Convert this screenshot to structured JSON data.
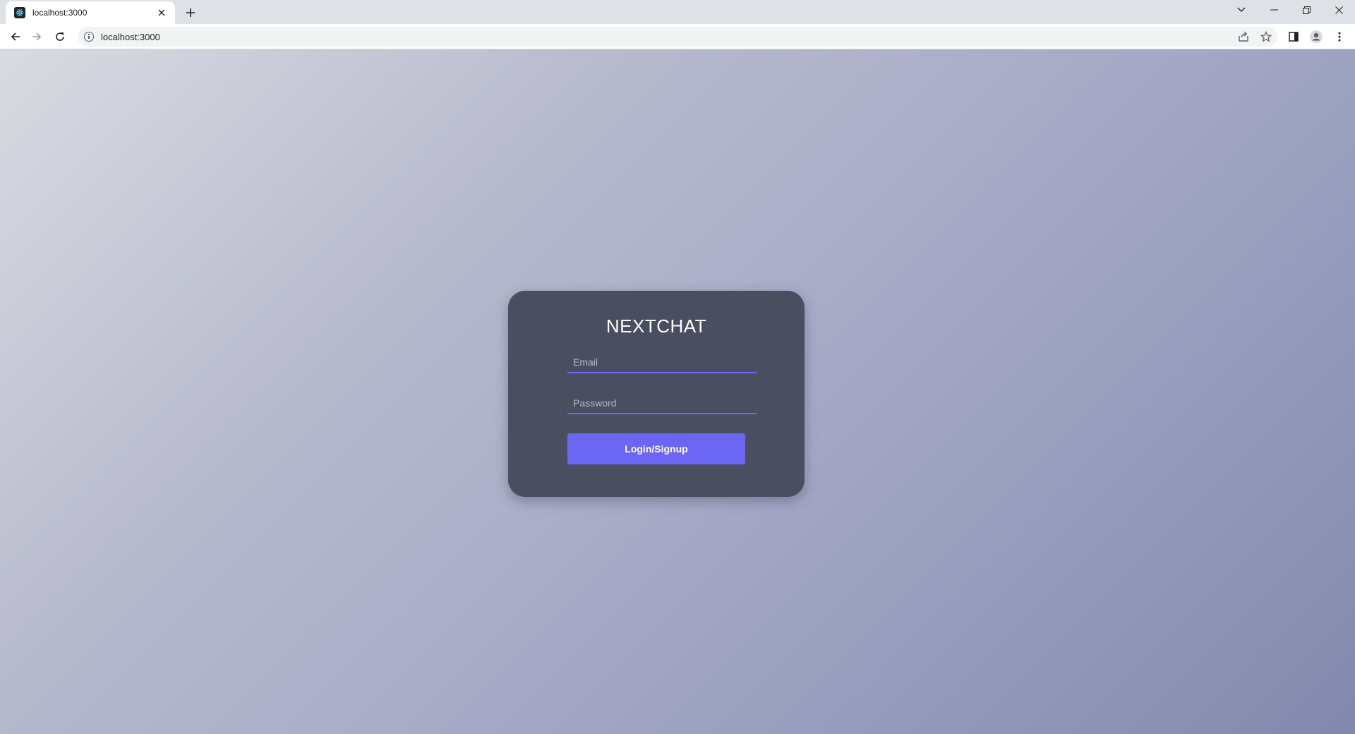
{
  "browser": {
    "tab_title": "localhost:3000",
    "url": "localhost:3000",
    "favicon": "react-icon"
  },
  "login": {
    "brand": "NEXTCHAT",
    "email_placeholder": "Email",
    "password_placeholder": "Password",
    "submit_label": "Login/Signup"
  },
  "colors": {
    "accent": "#6c66f5",
    "card_bg": "#4a4e61",
    "gradient_start": "#d9dbe2",
    "gradient_end": "#8389ad"
  }
}
